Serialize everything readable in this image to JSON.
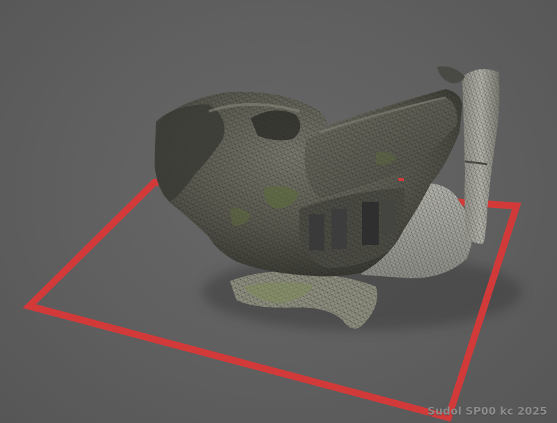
{
  "viewport": {
    "background_color": "#5f5f5f",
    "boundary_color": "#d23a3a",
    "model_palette": [
      "#3d3d38",
      "#55554d",
      "#6f6f65",
      "#8a8a80",
      "#5b6a3a",
      "#a7a7a0"
    ]
  },
  "watermark": {
    "text": "Sudol SP00 kc 2025"
  }
}
